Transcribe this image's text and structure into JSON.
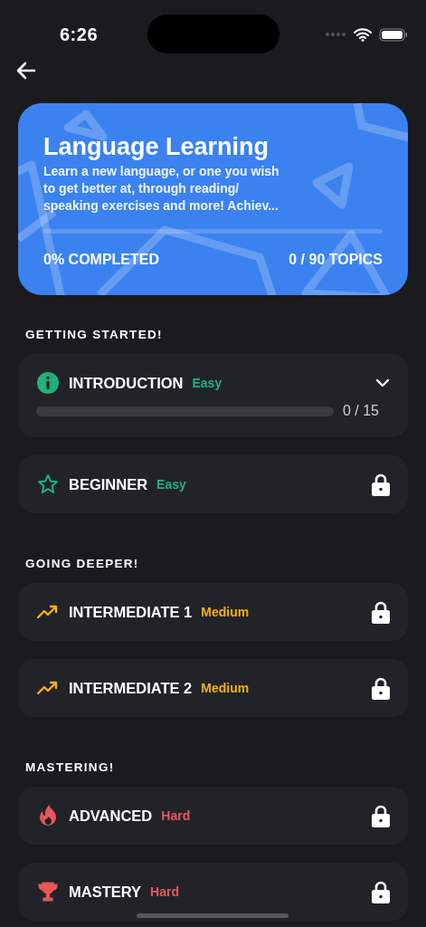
{
  "status_bar": {
    "time": "6:26"
  },
  "course": {
    "title": "Language Learning",
    "description": "Learn a new language, or one you wish to get better at, through reading/ speaking exercises and more! Achiev...",
    "level": 0,
    "completed": "0% COMPLETED",
    "topics": "0 / 90 TOPICS"
  },
  "sections": [
    {
      "heading": "GETTING STARTED!",
      "levels": [
        {
          "kind": "info",
          "name": "INTRODUCTION",
          "difficulty": "Easy",
          "color": "#22b07d",
          "locked": false,
          "expanded": false,
          "progress": {
            "level": 0,
            "reading": "0 / 15"
          }
        },
        {
          "kind": "star",
          "name": "BEGINNER",
          "difficulty": "Easy",
          "color": "#22b07d",
          "locked": true
        }
      ]
    },
    {
      "heading": "GOING DEEPER!",
      "levels": [
        {
          "kind": "trend",
          "name": "INTERMEDIATE 1",
          "difficulty": "Medium",
          "color": "#f5b014",
          "locked": true
        },
        {
          "kind": "trend",
          "name": "INTERMEDIATE 2",
          "difficulty": "Medium",
          "color": "#f5b014",
          "locked": true
        }
      ]
    },
    {
      "heading": "MASTERING!",
      "levels": [
        {
          "kind": "flame",
          "name": "ADVANCED",
          "difficulty": "Hard",
          "color": "#e5585b",
          "locked": true
        },
        {
          "kind": "trophy",
          "name": "MASTERY",
          "difficulty": "Hard",
          "color": "#e5585b",
          "locked": true
        }
      ]
    }
  ]
}
